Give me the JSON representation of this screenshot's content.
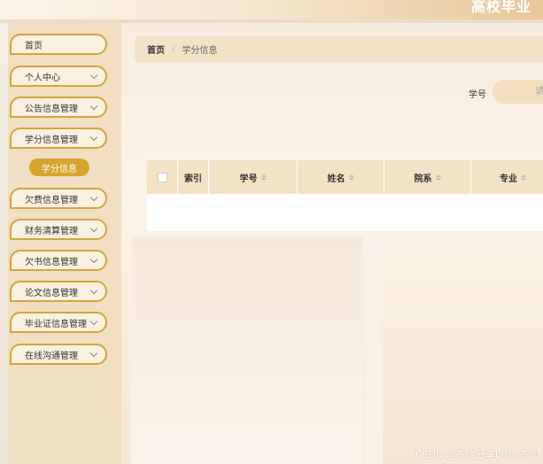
{
  "header": {
    "site_title": "高校毕业"
  },
  "sidebar": {
    "items": [
      {
        "label": "首页",
        "has_chevron": false
      },
      {
        "label": "个人中心",
        "has_chevron": true
      },
      {
        "label": "公告信息管理",
        "has_chevron": true
      },
      {
        "label": "学分信息管理",
        "has_chevron": true
      },
      {
        "label": "欠费信息管理",
        "has_chevron": true
      },
      {
        "label": "财务清算管理",
        "has_chevron": true
      },
      {
        "label": "欠书信息管理",
        "has_chevron": true
      },
      {
        "label": "论文信息管理",
        "has_chevron": true
      },
      {
        "label": "毕业证信息管理",
        "has_chevron": true
      },
      {
        "label": "在线沟通管理",
        "has_chevron": true
      }
    ],
    "active_subitem": "学分信息"
  },
  "breadcrumb": {
    "home": "首页",
    "separator": "/",
    "current": "学分信息"
  },
  "search": {
    "label": "学号",
    "placeholder": "请"
  },
  "table": {
    "columns": [
      "索引",
      "学号",
      "姓名",
      "院系",
      "专业"
    ],
    "rows": []
  },
  "watermark": "CSDN @专注分享bishe530",
  "colors": {
    "accent": "#d5a52d",
    "sidebar_bg": "#f0dfc3",
    "header_row": "#f3e2c6"
  }
}
